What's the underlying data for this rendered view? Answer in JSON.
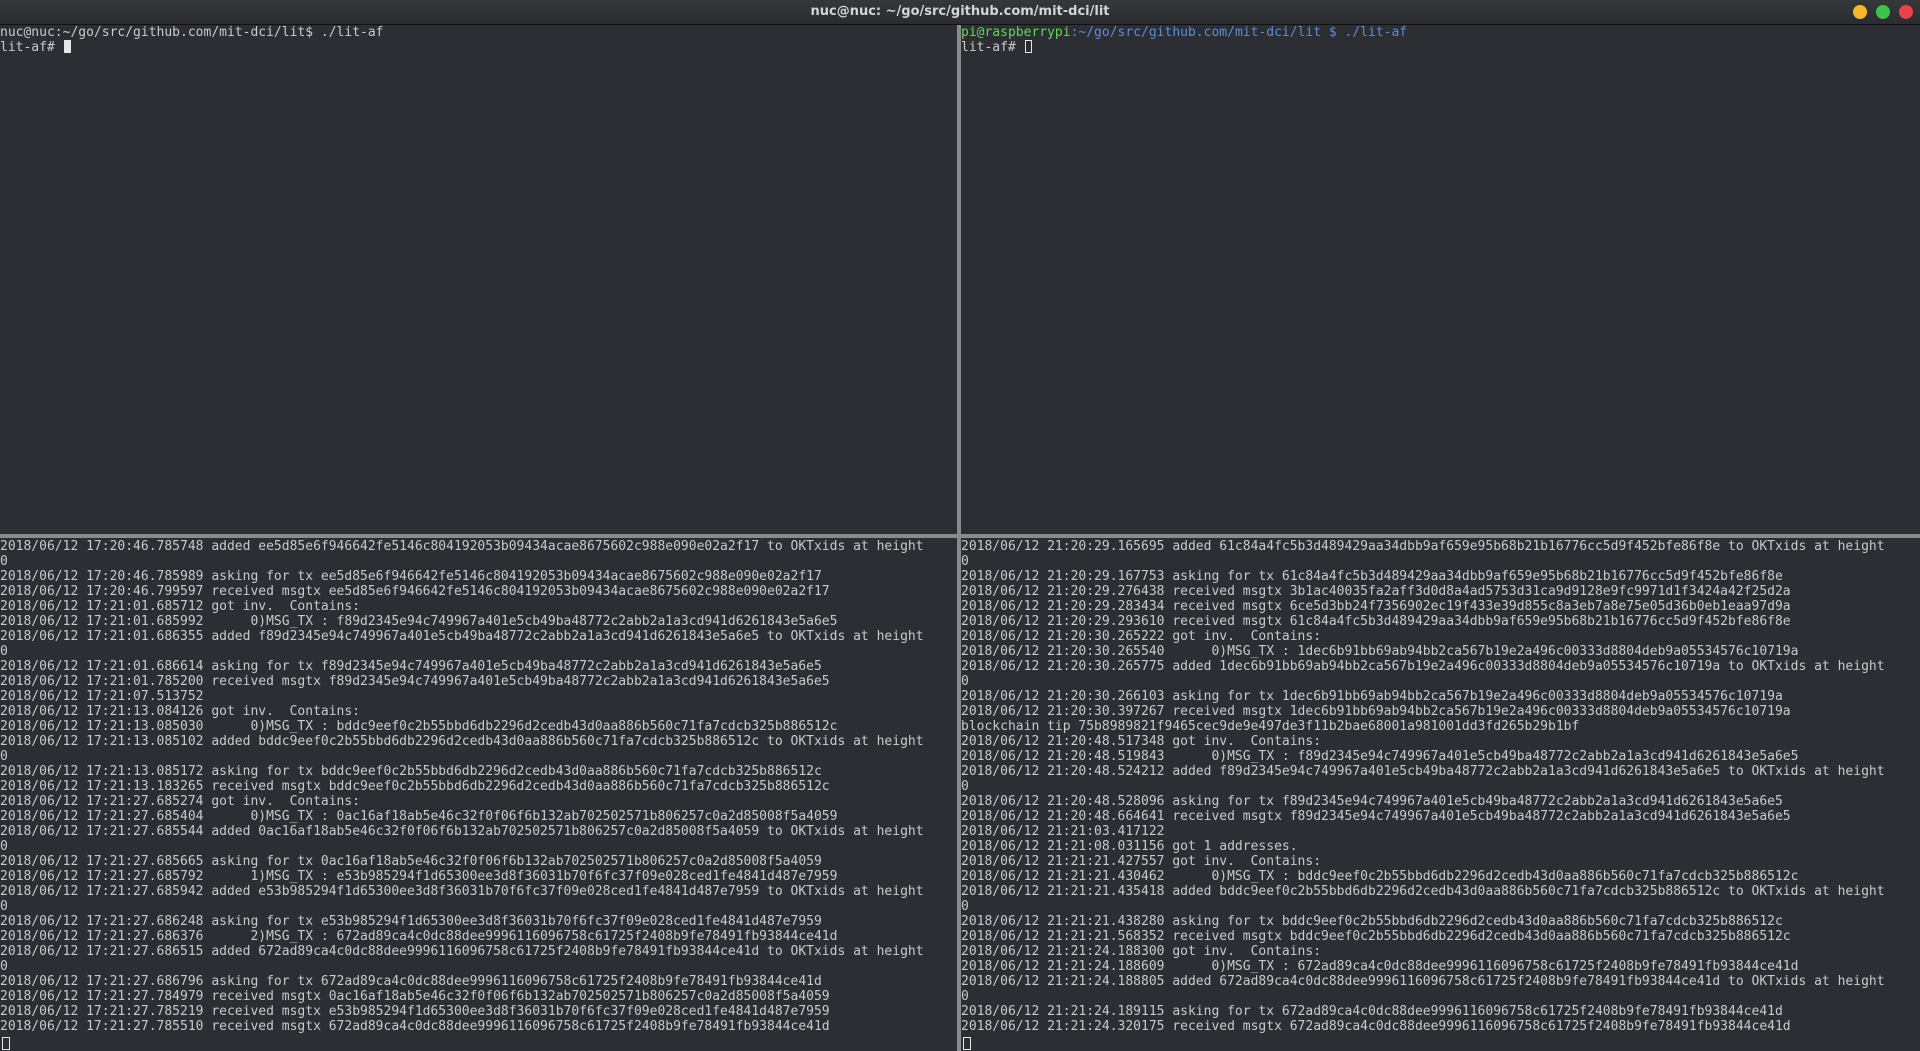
{
  "window": {
    "title": "nuc@nuc: ~/go/src/github.com/mit-dci/lit"
  },
  "pane_top_left": {
    "prompt": "nuc@nuc:~/go/src/github.com/mit-dci/lit$ ./lit-af",
    "lit_prompt": "lit-af# "
  },
  "pane_top_right": {
    "prompt_user": "pi@raspberrypi",
    "prompt_path": ":~/go/src/github.com/mit-dci/lit $ ./lit-af",
    "lit_prompt": "lit-af# "
  },
  "pane_bottom_left": {
    "lines": [
      "2018/06/12 17:20:46.785748 added ee5d85e6f946642fe5146c804192053b09434acae8675602c988e090e02a2f17 to OKTxids at height",
      "0",
      "2018/06/12 17:20:46.785989 asking for tx ee5d85e6f946642fe5146c804192053b09434acae8675602c988e090e02a2f17",
      "2018/06/12 17:20:46.799597 received msgtx ee5d85e6f946642fe5146c804192053b09434acae8675602c988e090e02a2f17",
      "2018/06/12 17:21:01.685712 got inv.  Contains:",
      "2018/06/12 17:21:01.685992      0)MSG_TX : f89d2345e94c749967a401e5cb49ba48772c2abb2a1a3cd941d6261843e5a6e5",
      "2018/06/12 17:21:01.686355 added f89d2345e94c749967a401e5cb49ba48772c2abb2a1a3cd941d6261843e5a6e5 to OKTxids at height",
      "0",
      "2018/06/12 17:21:01.686614 asking for tx f89d2345e94c749967a401e5cb49ba48772c2abb2a1a3cd941d6261843e5a6e5",
      "2018/06/12 17:21:01.785200 received msgtx f89d2345e94c749967a401e5cb49ba48772c2abb2a1a3cd941d6261843e5a6e5",
      "2018/06/12 17:21:07.513752",
      "2018/06/12 17:21:13.084126 got inv.  Contains:",
      "2018/06/12 17:21:13.085030      0)MSG_TX : bddc9eef0c2b55bbd6db2296d2cedb43d0aa886b560c71fa7cdcb325b886512c",
      "2018/06/12 17:21:13.085102 added bddc9eef0c2b55bbd6db2296d2cedb43d0aa886b560c71fa7cdcb325b886512c to OKTxids at height",
      "0",
      "2018/06/12 17:21:13.085172 asking for tx bddc9eef0c2b55bbd6db2296d2cedb43d0aa886b560c71fa7cdcb325b886512c",
      "2018/06/12 17:21:13.183265 received msgtx bddc9eef0c2b55bbd6db2296d2cedb43d0aa886b560c71fa7cdcb325b886512c",
      "2018/06/12 17:21:27.685274 got inv.  Contains:",
      "2018/06/12 17:21:27.685404      0)MSG_TX : 0ac16af18ab5e46c32f0f06f6b132ab702502571b806257c0a2d85008f5a4059",
      "2018/06/12 17:21:27.685544 added 0ac16af18ab5e46c32f0f06f6b132ab702502571b806257c0a2d85008f5a4059 to OKTxids at height",
      "0",
      "2018/06/12 17:21:27.685665 asking for tx 0ac16af18ab5e46c32f0f06f6b132ab702502571b806257c0a2d85008f5a4059",
      "2018/06/12 17:21:27.685792      1)MSG_TX : e53b985294f1d65300ee3d8f36031b70f6fc37f09e028ced1fe4841d487e7959",
      "2018/06/12 17:21:27.685942 added e53b985294f1d65300ee3d8f36031b70f6fc37f09e028ced1fe4841d487e7959 to OKTxids at height",
      "0",
      "2018/06/12 17:21:27.686248 asking for tx e53b985294f1d65300ee3d8f36031b70f6fc37f09e028ced1fe4841d487e7959",
      "2018/06/12 17:21:27.686376      2)MSG_TX : 672ad89ca4c0dc88dee9996116096758c61725f2408b9fe78491fb93844ce41d",
      "2018/06/12 17:21:27.686515 added 672ad89ca4c0dc88dee9996116096758c61725f2408b9fe78491fb93844ce41d to OKTxids at height",
      "0",
      "2018/06/12 17:21:27.686796 asking for tx 672ad89ca4c0dc88dee9996116096758c61725f2408b9fe78491fb93844ce41d",
      "2018/06/12 17:21:27.784979 received msgtx 0ac16af18ab5e46c32f0f06f6b132ab702502571b806257c0a2d85008f5a4059",
      "2018/06/12 17:21:27.785219 received msgtx e53b985294f1d65300ee3d8f36031b70f6fc37f09e028ced1fe4841d487e7959",
      "2018/06/12 17:21:27.785510 received msgtx 672ad89ca4c0dc88dee9996116096758c61725f2408b9fe78491fb93844ce41d"
    ]
  },
  "pane_bottom_right": {
    "lines": [
      "2018/06/12 21:20:29.165695 added 61c84a4fc5b3d489429aa34dbb9af659e95b68b21b16776cc5d9f452bfe86f8e to OKTxids at height",
      "0",
      "2018/06/12 21:20:29.167753 asking for tx 61c84a4fc5b3d489429aa34dbb9af659e95b68b21b16776cc5d9f452bfe86f8e",
      "2018/06/12 21:20:29.276438 received msgtx 3b1ac40035fa2aff3d0d8a4ad5753d31ca9d9128e9fc9971d1f3424a42f25d2a",
      "2018/06/12 21:20:29.283434 received msgtx 6ce5d3bb24f7356902ec19f433e39d855c8a3eb7a8e75e05d36b0eb1eaa97d9a",
      "2018/06/12 21:20:29.293610 received msgtx 61c84a4fc5b3d489429aa34dbb9af659e95b68b21b16776cc5d9f452bfe86f8e",
      "2018/06/12 21:20:30.265222 got inv.  Contains:",
      "2018/06/12 21:20:30.265540      0)MSG_TX : 1dec6b91bb69ab94bb2ca567b19e2a496c00333d8804deb9a05534576c10719a",
      "2018/06/12 21:20:30.265775 added 1dec6b91bb69ab94bb2ca567b19e2a496c00333d8804deb9a05534576c10719a to OKTxids at height",
      "0",
      "2018/06/12 21:20:30.266103 asking for tx 1dec6b91bb69ab94bb2ca567b19e2a496c00333d8804deb9a05534576c10719a",
      "2018/06/12 21:20:30.397267 received msgtx 1dec6b91bb69ab94bb2ca567b19e2a496c00333d8804deb9a05534576c10719a",
      "blockchain tip 75b8989821f9465cec9de9e497de3f11b2bae68001a981001dd3fd265b29b1bf",
      "2018/06/12 21:20:48.517348 got inv.  Contains:",
      "2018/06/12 21:20:48.519843      0)MSG_TX : f89d2345e94c749967a401e5cb49ba48772c2abb2a1a3cd941d6261843e5a6e5",
      "2018/06/12 21:20:48.524212 added f89d2345e94c749967a401e5cb49ba48772c2abb2a1a3cd941d6261843e5a6e5 to OKTxids at height",
      "0",
      "2018/06/12 21:20:48.528096 asking for tx f89d2345e94c749967a401e5cb49ba48772c2abb2a1a3cd941d6261843e5a6e5",
      "2018/06/12 21:20:48.664641 received msgtx f89d2345e94c749967a401e5cb49ba48772c2abb2a1a3cd941d6261843e5a6e5",
      "2018/06/12 21:21:03.417122",
      "2018/06/12 21:21:08.031156 got 1 addresses.",
      "2018/06/12 21:21:21.427557 got inv.  Contains:",
      "2018/06/12 21:21:21.430462      0)MSG_TX : bddc9eef0c2b55bbd6db2296d2cedb43d0aa886b560c71fa7cdcb325b886512c",
      "2018/06/12 21:21:21.435418 added bddc9eef0c2b55bbd6db2296d2cedb43d0aa886b560c71fa7cdcb325b886512c to OKTxids at height",
      "0",
      "2018/06/12 21:21:21.438280 asking for tx bddc9eef0c2b55bbd6db2296d2cedb43d0aa886b560c71fa7cdcb325b886512c",
      "2018/06/12 21:21:21.568352 received msgtx bddc9eef0c2b55bbd6db2296d2cedb43d0aa886b560c71fa7cdcb325b886512c",
      "2018/06/12 21:21:24.188300 got inv.  Contains:",
      "2018/06/12 21:21:24.188609      0)MSG_TX : 672ad89ca4c0dc88dee9996116096758c61725f2408b9fe78491fb93844ce41d",
      "2018/06/12 21:21:24.188805 added 672ad89ca4c0dc88dee9996116096758c61725f2408b9fe78491fb93844ce41d to OKTxids at height",
      "0",
      "2018/06/12 21:21:24.189115 asking for tx 672ad89ca4c0dc88dee9996116096758c61725f2408b9fe78491fb93844ce41d",
      "2018/06/12 21:21:24.320175 received msgtx 672ad89ca4c0dc88dee9996116096758c61725f2408b9fe78491fb93844ce41d"
    ]
  }
}
